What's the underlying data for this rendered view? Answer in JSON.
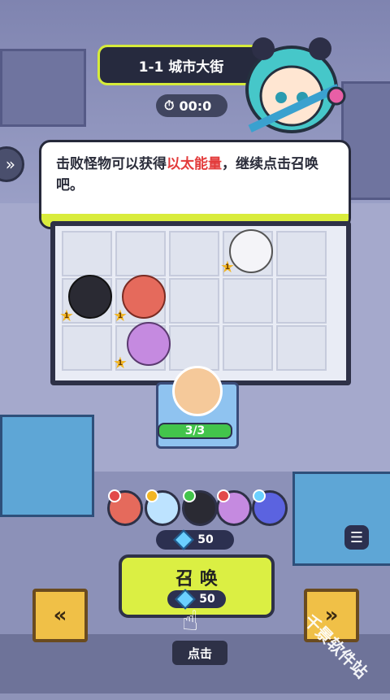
{
  "stage": {
    "title": "1-1 城市大街"
  },
  "timer": {
    "value": "00:0"
  },
  "dialog": {
    "part1": "击败怪物可以获得",
    "highlight": "以太能量",
    "part2": "，继续点击召唤吧。"
  },
  "board": {
    "units": [
      {
        "name": "white-hair-unit",
        "level": "1",
        "color": "#f4f4f8"
      },
      {
        "name": "black-hair-unit",
        "level": "1",
        "color": "#2a2a33"
      },
      {
        "name": "red-hood-unit",
        "level": "1",
        "color": "#e56a5c"
      },
      {
        "name": "feather-hat-unit",
        "level": "1",
        "color": "#c58ae0"
      }
    ]
  },
  "summon_slot": {
    "count": "3/3",
    "fill": 1.0
  },
  "roster": [
    "#e56a5c",
    "#bde3ff",
    "#2a2a33",
    "#c58ae0",
    "#5b63e0"
  ],
  "currency": {
    "amount": "50"
  },
  "summon_button": {
    "label": "召 唤",
    "cost": "50"
  },
  "tap_hint": {
    "label": "点击"
  },
  "watermark": {
    "text": "千景软件站"
  },
  "colors": {
    "accent": "#dbef43",
    "highlight": "#e33b3b",
    "dark": "#2e3147"
  }
}
